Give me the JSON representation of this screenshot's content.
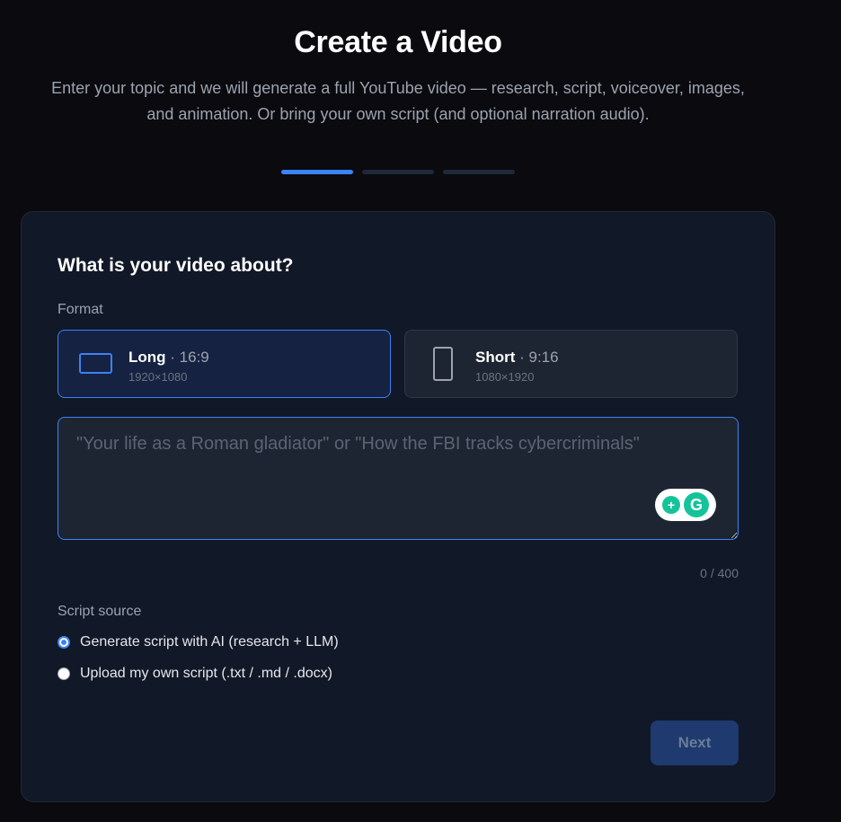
{
  "header": {
    "title": "Create a Video",
    "subtitle": "Enter your topic and we will generate a full YouTube video — research, script, voiceover, images, and animation. Or bring your own script (and optional narration audio)."
  },
  "steps": {
    "total": 3,
    "current": 1
  },
  "card": {
    "heading": "What is your video about?",
    "format_label": "Format",
    "formats": [
      {
        "name": "Long",
        "ratio": "· 16:9",
        "dims": "1920×1080",
        "selected": true,
        "icon": "landscape-screen-icon"
      },
      {
        "name": "Short",
        "ratio": "· 9:16",
        "dims": "1080×1920",
        "selected": false,
        "icon": "phone-portrait-icon"
      }
    ],
    "topic": {
      "value": "",
      "placeholder": "\"Your life as a Roman gladiator\" or \"How the FBI tracks cybercriminals\""
    },
    "counter": "0 / 400",
    "script_label": "Script source",
    "script_options": [
      {
        "label": "Generate script with AI (research + LLM)",
        "checked": true
      },
      {
        "label": "Upload my own script (.txt / .md / .docx)",
        "checked": false
      }
    ],
    "next_label": "Next"
  },
  "colors": {
    "accent": "#3b82f6",
    "background": "#0a0a0f",
    "card": "#111827",
    "grammarly": "#15c39a"
  }
}
